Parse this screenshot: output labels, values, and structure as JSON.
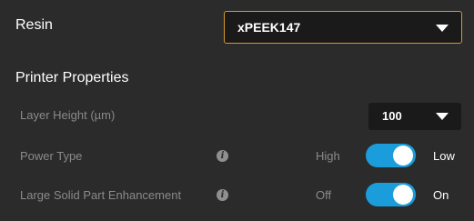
{
  "resin": {
    "label": "Resin",
    "selected": "xPEEK147"
  },
  "printer_properties": {
    "title": "Printer Properties",
    "layer_height": {
      "label": "Layer Height (µm)",
      "selected": "100"
    },
    "power_type": {
      "label": "Power Type",
      "off_label": "High",
      "on_label": "Low",
      "toggled_on": true
    },
    "large_solid_part": {
      "label": "Large Solid Part Enhancement",
      "off_label": "Off",
      "on_label": "On",
      "toggled_on": true
    }
  },
  "info_glyph": "i",
  "colors": {
    "background": "#2b2b2b",
    "dropdown_bg": "#1a1a1a",
    "accent_border": "#d39a2c",
    "toggle_on": "#1b9ddb",
    "muted_text": "#8a8a8a"
  }
}
